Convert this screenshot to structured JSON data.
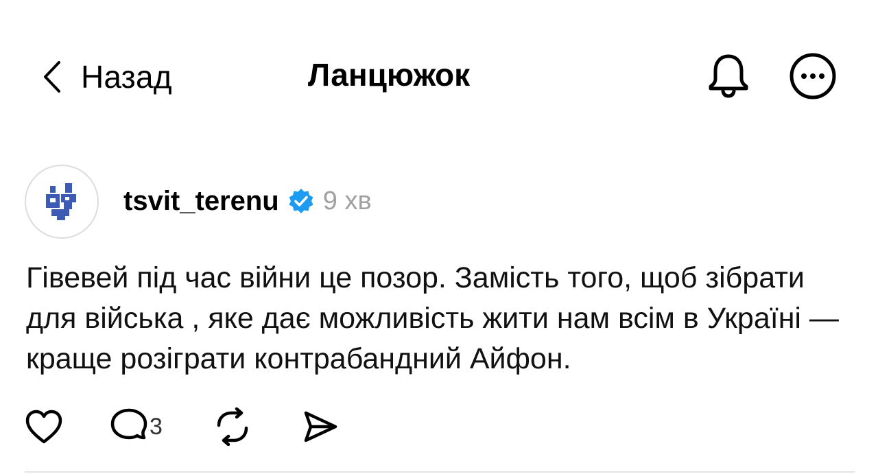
{
  "header": {
    "back_label": "Назад",
    "back_icon": "chevron-left-icon",
    "title": "Ланцюжок",
    "bell_icon": "bell-icon",
    "more_icon": "more-horizontal-icon"
  },
  "post": {
    "avatar_icon": "brand-logo-avatar",
    "username": "tsvit_terenu",
    "verified_icon": "verified-badge-icon",
    "timestamp": "9 хв",
    "text": "Гівевей під час війни це позор. Замість того, щоб зібрати для війська , яке дає можливість жити нам всім в Україні — краще розіграти контрабандний Айфон.",
    "actions": {
      "like_icon": "heart-icon",
      "reply_icon": "comment-icon",
      "reply_count": "3",
      "repost_icon": "repost-icon",
      "share_icon": "send-icon"
    }
  },
  "colors": {
    "accent_verified": "#1d9bf0",
    "avatar_logo": "#3b5bb5",
    "muted_text": "#a0a0a0",
    "divider": "#e4e4e4"
  }
}
